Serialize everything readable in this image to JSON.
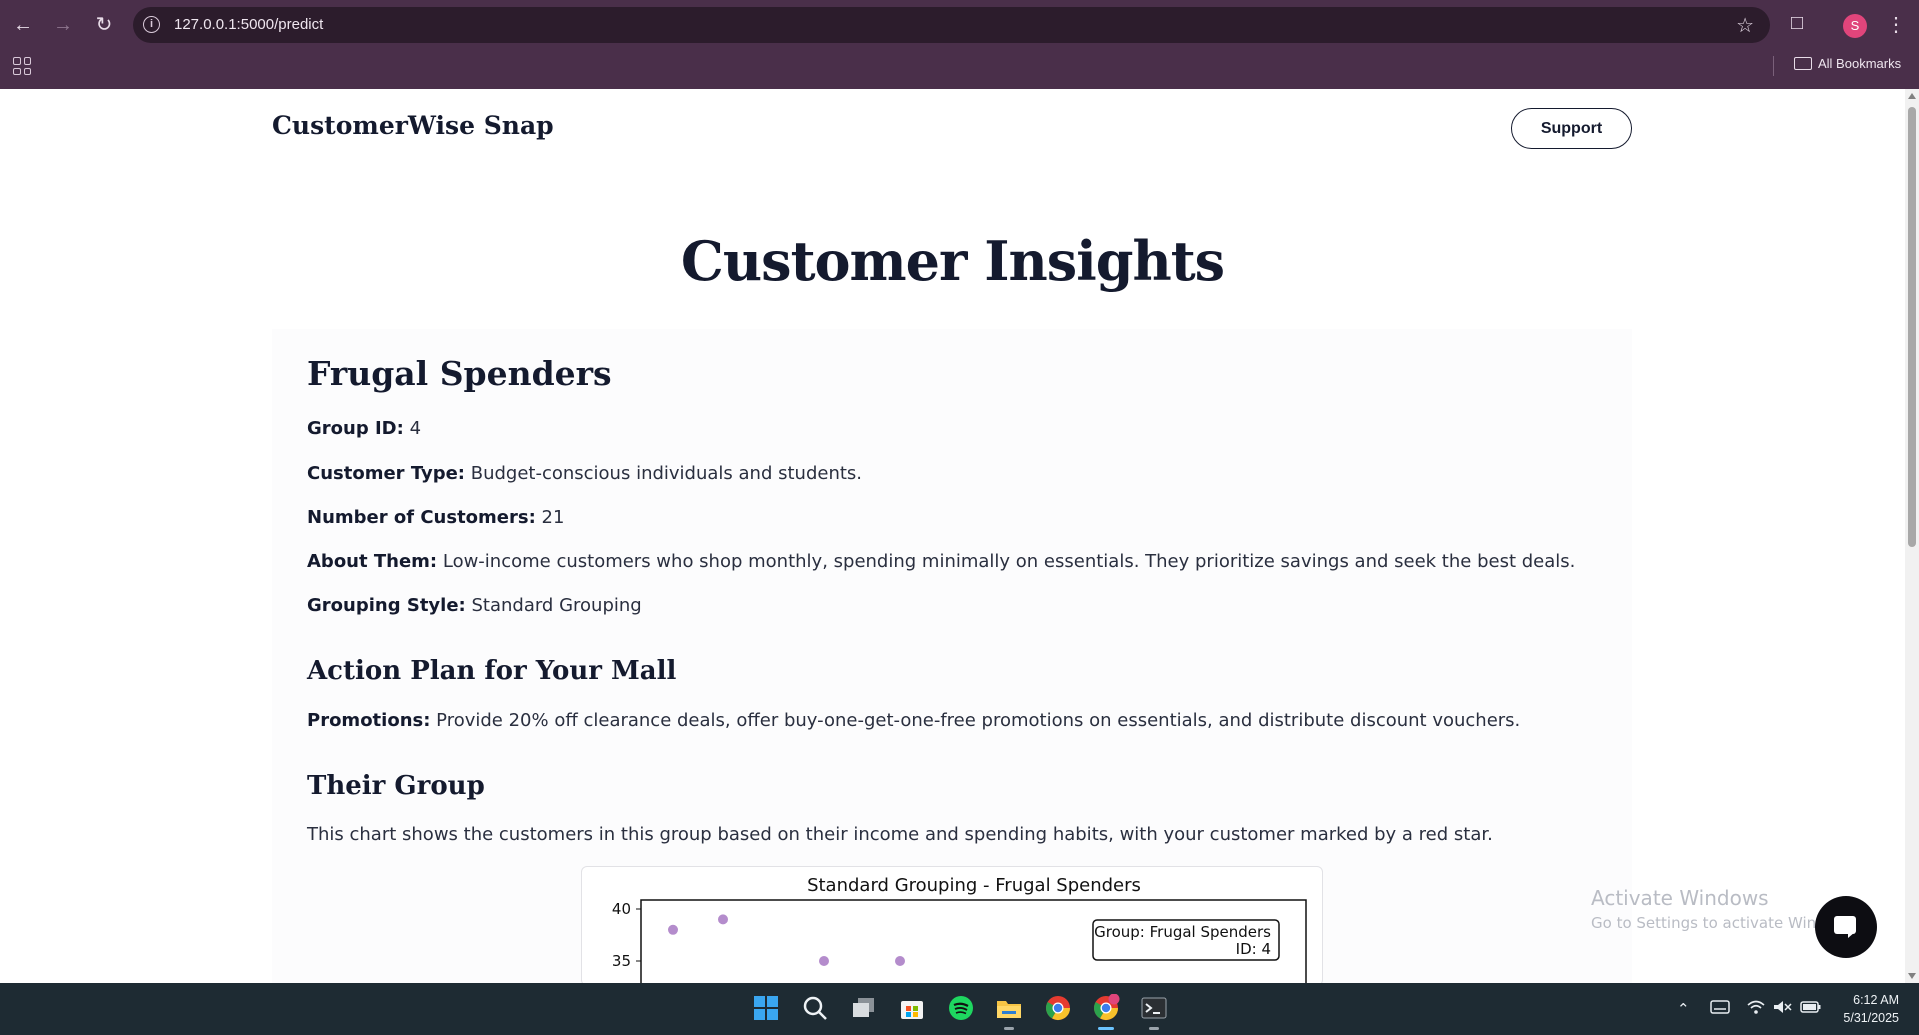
{
  "browser": {
    "url": "127.0.0.1:5000/predict",
    "bookmarks_label": "All Bookmarks",
    "profile_initial": "S"
  },
  "site": {
    "brand": "CustomerWise Snap",
    "support_label": "Support"
  },
  "page": {
    "title": "Customer Insights",
    "segment_name": "Frugal Spenders",
    "fields": [
      {
        "label": "Group ID:",
        "value": "4"
      },
      {
        "label": "Customer Type:",
        "value": "Budget-conscious individuals and students."
      },
      {
        "label": "Number of Customers:",
        "value": "21"
      },
      {
        "label": "About Them:",
        "value": "Low-income customers who shop monthly, spending minimally on essentials. They prioritize savings and seek the best deals."
      },
      {
        "label": "Grouping Style:",
        "value": "Standard Grouping"
      }
    ],
    "action_plan_heading": "Action Plan for Your Mall",
    "promotions_label": "Promotions:",
    "promotions_value": "Provide 20% off clearance deals, offer buy-one-get-one-free promotions on essentials, and distribute discount vouchers.",
    "group_heading": "Their Group",
    "group_description": "This chart shows the customers in this group based on their income and spending habits, with your customer marked by a red star."
  },
  "chart_data": {
    "type": "scatter",
    "title": "Standard Grouping - Frugal Spenders",
    "y_ticks": [
      "40",
      "35"
    ],
    "legend_lines": [
      "Group: Frugal Spenders",
      "ID: 4"
    ],
    "point_color": "#b48ccc",
    "points_visible": [
      {
        "y": 38
      },
      {
        "y": 39
      },
      {
        "y": 35
      },
      {
        "y": 35
      }
    ]
  },
  "overlay": {
    "activate_title": "Activate Windows",
    "activate_sub": "Go to Settings to activate Windows."
  },
  "taskbar": {
    "time": "6:12 AM",
    "date": "5/31/2025",
    "apps": [
      "windows-start-icon",
      "search-icon",
      "task-view-icon",
      "store-icon",
      "spotify-icon",
      "file-explorer-icon",
      "chrome-icon",
      "chrome-profile-icon",
      "terminal-icon"
    ]
  }
}
